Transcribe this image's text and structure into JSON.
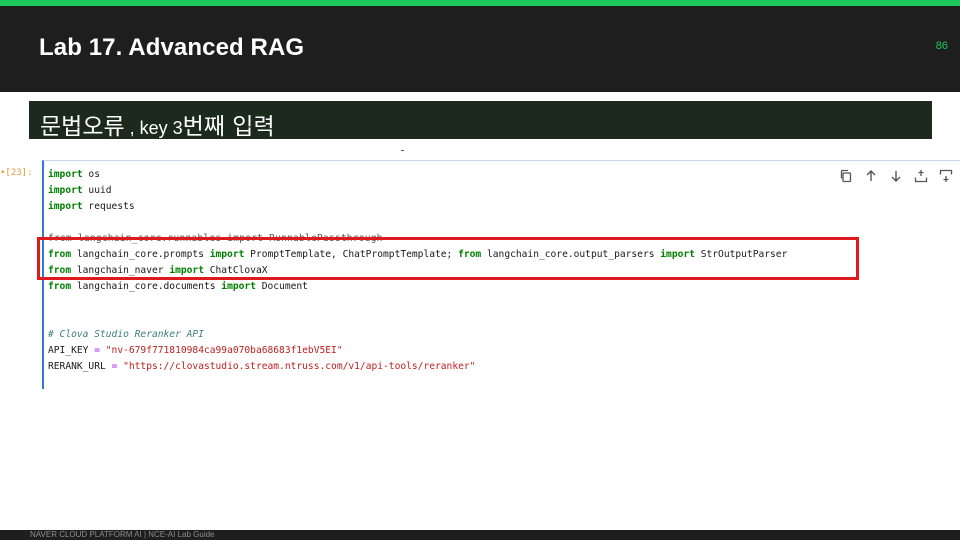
{
  "header": {
    "title": "Lab 17. Advanced RAG",
    "page_number": "86",
    "accent_color": "#1ec85a"
  },
  "subtitle": {
    "part1": "문법오류",
    "part2": " , key 3",
    "part3": "번째 입력"
  },
  "cell": {
    "execution_count": "•[23]:",
    "toolbar": [
      {
        "icon": "copy-icon"
      },
      {
        "icon": "arrow-up-icon"
      },
      {
        "icon": "arrow-down-icon"
      },
      {
        "icon": "insert-above-icon"
      },
      {
        "icon": "insert-below-icon"
      }
    ],
    "code": {
      "l1_kw": "import",
      "l1_rest": " os",
      "l2_kw": "import",
      "l2_rest": " uuid",
      "l3_kw": "import",
      "l3_rest": " requests",
      "l4_text": "from langchain_core.runnables import RunnablePassthrough",
      "l5_kw1": "from",
      "l5_mod1": " langchain_core.prompts ",
      "l5_kw2": "import",
      "l5_names": " PromptTemplate, ChatPromptTemplate; ",
      "l5_kw3": "from",
      "l5_mod2": " langchain_core.output_parsers ",
      "l5_kw4": "import",
      "l5_name2": " StrOutputParser",
      "l6_kw1": "from",
      "l6_mod": " langchain_naver ",
      "l6_kw2": "import",
      "l6_name": " ChatClovaX",
      "l7_kw1": "from",
      "l7_mod": " langchain_core.documents ",
      "l7_kw2": "import",
      "l7_name": " Document",
      "l8_comment": "# Clova Studio Reranker API",
      "l9_name": "API_KEY ",
      "l9_op": "=",
      "l9_str": " \"nv-679f771810984ca99a070ba68683f1ebV5EI\"",
      "l10_name": "RERANK_URL ",
      "l10_op": "=",
      "l10_str": " \"https://clovastudio.stream.ntruss.com/v1/api-tools/reranker\""
    }
  },
  "highlight_color": "#e0191f",
  "footer": {
    "text": "NAVER CLOUD PLATFORM AI  |  NCE-AI Lab Guide"
  }
}
